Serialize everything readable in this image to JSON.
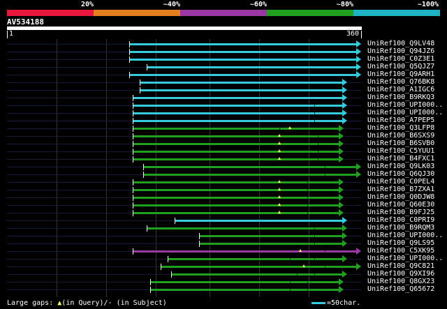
{
  "scale": {
    "labels": [
      "20%",
      "~40%",
      "~60%",
      "~80%",
      "~100%"
    ],
    "colors": [
      "#e8173b",
      "#e6801e",
      "#9b36a5",
      "#1fa01f",
      "#1fb4c4"
    ]
  },
  "query": {
    "name": "AV534188",
    "start": "1",
    "end": "360"
  },
  "hits": [
    {
      "label": "UniRef100_Q9LV48",
      "start": 0.35,
      "end": 1.0,
      "color": "#33ccdd",
      "gaps": [],
      "qgaps": []
    },
    {
      "label": "UniRef100_Q94JZ6",
      "start": 0.35,
      "end": 1.0,
      "color": "#33ccdd",
      "gaps": [],
      "qgaps": []
    },
    {
      "label": "UniRef100_C0Z3E1",
      "start": 0.35,
      "end": 1.0,
      "color": "#33ccdd",
      "gaps": [],
      "qgaps": []
    },
    {
      "label": "UniRef100_Q5QJZ7",
      "start": 0.4,
      "end": 1.0,
      "color": "#33ccdd",
      "gaps": [],
      "qgaps": []
    },
    {
      "label": "UniRef100_Q9ARH1",
      "start": 0.35,
      "end": 1.0,
      "color": "#33ccdd",
      "gaps": [],
      "qgaps": []
    },
    {
      "label": "UniRef100_Q76BK8",
      "start": 0.38,
      "end": 0.96,
      "color": "#33ccdd",
      "gaps": [],
      "qgaps": []
    },
    {
      "label": "UniRef100_A1IGC6",
      "start": 0.38,
      "end": 0.96,
      "color": "#33ccdd",
      "gaps": [],
      "qgaps": []
    },
    {
      "label": "UniRef100_B9RKQ3",
      "start": 0.36,
      "end": 0.96,
      "color": "#33ccdd",
      "gaps": [],
      "qgaps": []
    },
    {
      "label": "UniRef100_UPI000..",
      "start": 0.36,
      "end": 0.96,
      "color": "#33ccdd",
      "gaps": [
        0.88
      ],
      "qgaps": []
    },
    {
      "label": "UniRef100_UPI000..",
      "start": 0.36,
      "end": 0.96,
      "color": "#33ccdd",
      "gaps": [
        0.88
      ],
      "qgaps": []
    },
    {
      "label": "UniRef100_A7PEP5",
      "start": 0.36,
      "end": 0.96,
      "color": "#33ccdd",
      "gaps": [
        0.88
      ],
      "qgaps": []
    },
    {
      "label": "UniRef100_Q3LFP8",
      "start": 0.36,
      "end": 0.95,
      "color": "#1fa01f",
      "gaps": [
        0.78
      ],
      "qgaps": [
        0.81
      ]
    },
    {
      "label": "UniRef100_B6SXS9",
      "start": 0.36,
      "end": 0.95,
      "color": "#1fa01f",
      "gaps": [
        0.89
      ],
      "qgaps": [
        0.78
      ]
    },
    {
      "label": "UniRef100_B6SVB0",
      "start": 0.36,
      "end": 0.95,
      "color": "#1fa01f",
      "gaps": [
        0.89
      ],
      "qgaps": [
        0.78
      ]
    },
    {
      "label": "UniRef100_C5YUU1",
      "start": 0.36,
      "end": 0.95,
      "color": "#1fa01f",
      "gaps": [
        0.89
      ],
      "qgaps": [
        0.78
      ]
    },
    {
      "label": "UniRef100_B4FXC1",
      "start": 0.36,
      "end": 0.95,
      "color": "#1fa01f",
      "gaps": [
        0.89
      ],
      "qgaps": [
        0.78
      ]
    },
    {
      "label": "UniRef100_Q9LK03",
      "start": 0.39,
      "end": 1.0,
      "color": "#1fa01f",
      "gaps": [
        0.91
      ],
      "qgaps": []
    },
    {
      "label": "UniRef100_Q6QJ30",
      "start": 0.39,
      "end": 1.0,
      "color": "#1fa01f",
      "gaps": [
        0.91
      ],
      "qgaps": []
    },
    {
      "label": "UniRef100_C0PEL4",
      "start": 0.36,
      "end": 0.95,
      "color": "#1fa01f",
      "gaps": [
        0.86
      ],
      "qgaps": [
        0.78
      ]
    },
    {
      "label": "UniRef100_B7ZXA1",
      "start": 0.36,
      "end": 0.95,
      "color": "#1fa01f",
      "gaps": [
        0.86
      ],
      "qgaps": [
        0.78
      ]
    },
    {
      "label": "UniRef100_Q0DJW8",
      "start": 0.36,
      "end": 0.95,
      "color": "#1fa01f",
      "gaps": [
        0.86
      ],
      "qgaps": [
        0.78
      ]
    },
    {
      "label": "UniRef100_Q60E30",
      "start": 0.36,
      "end": 0.95,
      "color": "#1fa01f",
      "gaps": [
        0.86
      ],
      "qgaps": [
        0.78
      ]
    },
    {
      "label": "UniRef100_B9FJ25",
      "start": 0.36,
      "end": 0.95,
      "color": "#1fa01f",
      "gaps": [
        0.86
      ],
      "qgaps": [
        0.78
      ]
    },
    {
      "label": "UniRef100_C0PRI9",
      "start": 0.48,
      "end": 0.96,
      "color": "#33ccdd",
      "gaps": [],
      "qgaps": []
    },
    {
      "label": "UniRef100_B9RQM3",
      "start": 0.4,
      "end": 0.96,
      "color": "#1fa01f",
      "gaps": [
        0.88
      ],
      "qgaps": []
    },
    {
      "label": "UniRef100_UPI000..",
      "start": 0.55,
      "end": 0.96,
      "color": "#1fa01f",
      "gaps": [
        0.88
      ],
      "qgaps": []
    },
    {
      "label": "UniRef100_Q9LS95",
      "start": 0.55,
      "end": 0.96,
      "color": "#1fa01f",
      "gaps": [
        0.88
      ],
      "qgaps": []
    },
    {
      "label": "UniRef100_C5XK95",
      "start": 0.36,
      "end": 1.0,
      "color": "#9b36a5",
      "gaps": [
        0.91
      ],
      "qgaps": [
        0.84
      ]
    },
    {
      "label": "UniRef100_UPI000..",
      "start": 0.46,
      "end": 0.96,
      "color": "#1fa01f",
      "gaps": [
        0.81,
        0.88
      ],
      "qgaps": []
    },
    {
      "label": "UniRef100_Q9C821",
      "start": 0.44,
      "end": 1.0,
      "color": "#1fa01f",
      "gaps": [
        0.91
      ],
      "qgaps": [
        0.85
      ]
    },
    {
      "label": "UniRef100_Q9XI96",
      "start": 0.47,
      "end": 0.96,
      "color": "#1fa01f",
      "gaps": [
        0.83,
        0.88
      ],
      "qgaps": []
    },
    {
      "label": "UniRef100_Q8GX23",
      "start": 0.41,
      "end": 0.95,
      "color": "#1fa01f",
      "gaps": [
        0.81,
        0.86
      ],
      "qgaps": []
    },
    {
      "label": "UniRef100_Q65672",
      "start": 0.41,
      "end": 0.95,
      "color": "#1fa01f",
      "gaps": [
        0.81,
        0.86
      ],
      "qgaps": []
    }
  ],
  "legend": {
    "prefix": "Large gaps:",
    "triangle": "▲",
    "text": "(in Query)/- (in Subject)",
    "scale_text": "=50char."
  }
}
